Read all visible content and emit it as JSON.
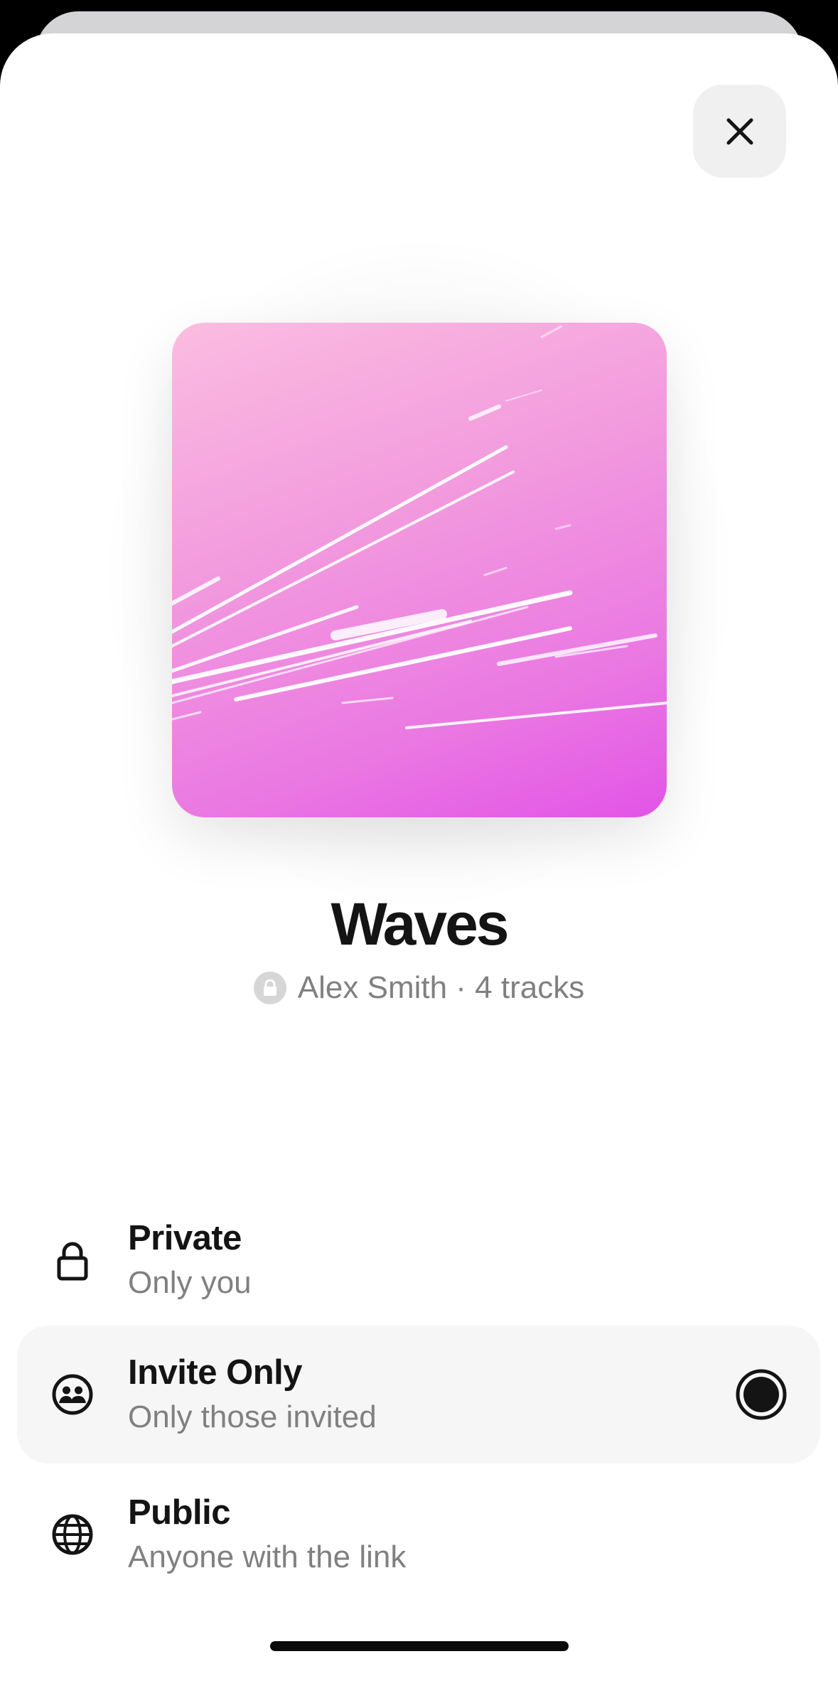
{
  "playlist": {
    "title": "Waves",
    "meta": "Alex Smith · 4 tracks",
    "cover_colors": [
      "#fbbde0",
      "#e254e6"
    ]
  },
  "close_button": {
    "icon": "close-icon"
  },
  "privacy_options": [
    {
      "title": "Private",
      "subtitle": "Only you",
      "icon": "lock-icon",
      "selected": false
    },
    {
      "title": "Invite Only",
      "subtitle": "Only those invited",
      "icon": "people-icon",
      "selected": true
    },
    {
      "title": "Public",
      "subtitle": "Anyone with the link",
      "icon": "globe-icon",
      "selected": false
    }
  ],
  "colors": {
    "accent": "#141414",
    "selected_row": "#f6f6f6",
    "secondary_text": "#808080"
  }
}
